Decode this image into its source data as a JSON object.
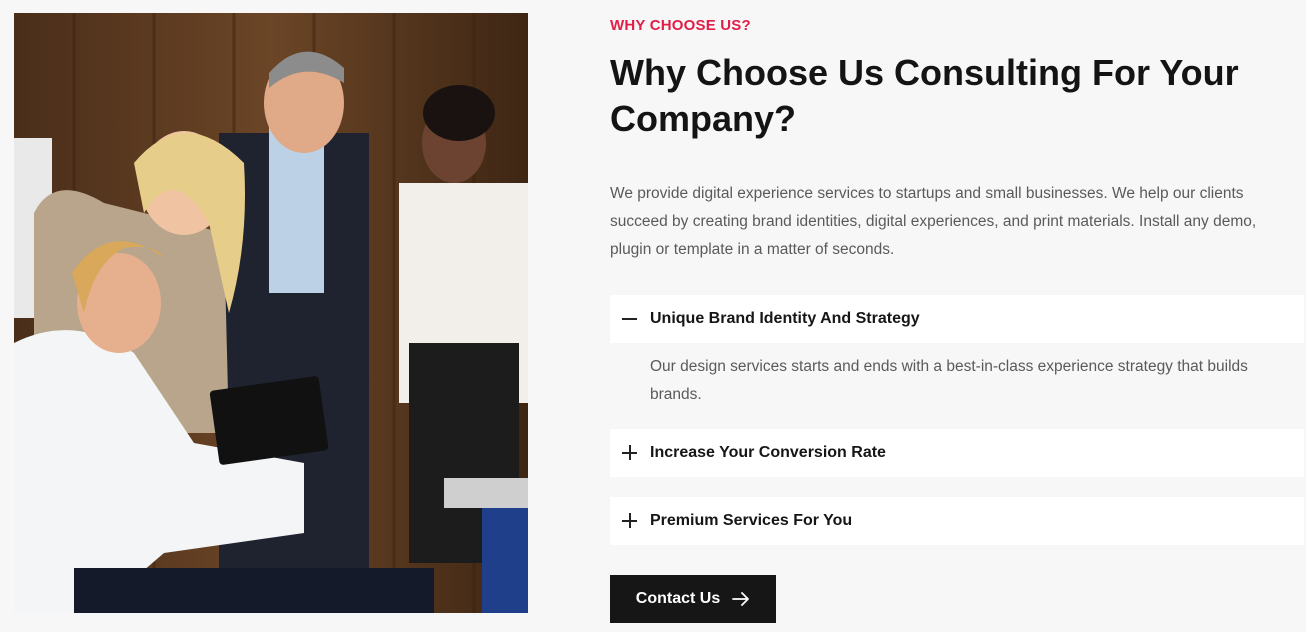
{
  "section": {
    "eyebrow": "WHY CHOOSE US?",
    "title": "Why Choose Us Consulting For Your Company?",
    "description": "We provide digital experience services to startups and small businesses. We help our clients succeed by creating brand identities, digital experiences, and print materials. Install any demo, plugin or template in a matter of seconds."
  },
  "accordion": {
    "items": [
      {
        "label": "Unique Brand Identity And Strategy",
        "expanded": true,
        "body": "Our design services starts and ends with a best-in-class experience strategy that builds brands."
      },
      {
        "label": "Increase Your Conversion Rate",
        "expanded": false
      },
      {
        "label": "Premium Services For You",
        "expanded": false
      }
    ]
  },
  "cta": {
    "label": "Contact Us",
    "icon": "arrow-right-icon"
  },
  "colors": {
    "accent": "#e11d48",
    "heading": "#141414",
    "button_bg": "#161616",
    "page_bg": "#f7f7f7"
  }
}
